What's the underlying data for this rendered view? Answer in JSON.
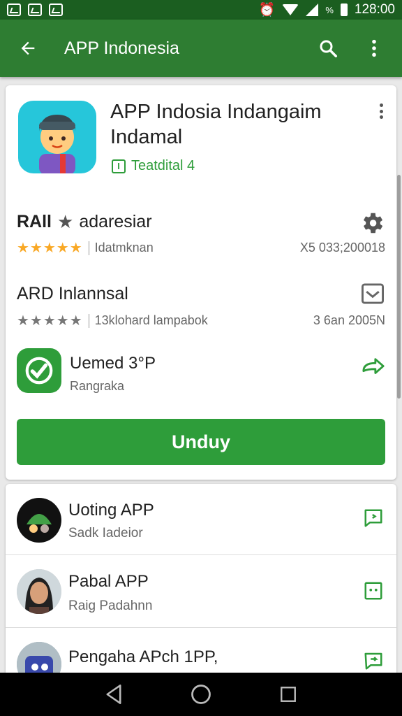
{
  "status_bar": {
    "time": "128:00",
    "extra": "%"
  },
  "app_bar": {
    "title": "APP Indonesia"
  },
  "app": {
    "title": "APP Indosia Indangaim Indamal",
    "badge": "Teatdital 4",
    "install_label": "Unduy"
  },
  "rows": [
    {
      "title": "RAll",
      "title_suffix": "adaresiar",
      "stars": "★★★★★",
      "meta": "Idatmknan",
      "right_text": "X5 033;200018",
      "right_icon": "gear-icon"
    },
    {
      "title": "ARD Inlannsal",
      "stars": "★★★★★",
      "meta": "13klohard lampabok",
      "right_text": "3  6an 2005N",
      "right_icon": "inbox-icon"
    }
  ],
  "update_row": {
    "title": "Uemed 3°P",
    "subtitle": "Rangraka"
  },
  "list": [
    {
      "title": "Uoting APP",
      "subtitle": "Sadk Iadeior"
    },
    {
      "title": "Pabal APP",
      "subtitle": "Raig Padahnn"
    },
    {
      "title": "Pengaha APch 1PP,",
      "subtitle": ""
    }
  ],
  "colors": {
    "appbar": "#2e7d32",
    "status_bar": "#1b5e20",
    "accent": "#2e9d3a",
    "icon_bg": "#26c6da"
  }
}
